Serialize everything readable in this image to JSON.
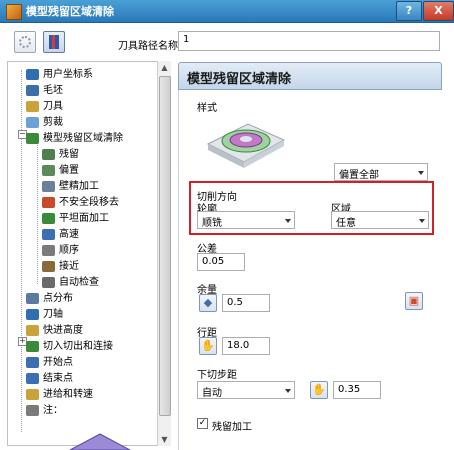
{
  "window": {
    "title": "模型残留区域清除",
    "help_label": "?",
    "close_label": "X"
  },
  "toolpath_name": {
    "label": "刀具路径名称",
    "value": "1"
  },
  "tree": {
    "items": [
      {
        "label": "用户坐标系",
        "icon": "ucs-icon",
        "color": "#2f6fb0"
      },
      {
        "label": "毛坯",
        "icon": "block-icon",
        "color": "#3c6ea8"
      },
      {
        "label": "刀具",
        "icon": "tool-icon",
        "color": "#c9a23a"
      },
      {
        "label": "剪裁",
        "icon": "trim-icon",
        "color": "#6aa2d8"
      },
      {
        "label": "模型残留区域清除",
        "icon": "strategy-icon",
        "color": "#3a8a3a"
      },
      {
        "label": "残留",
        "icon": "rest-icon",
        "color": "#4f7f4f"
      },
      {
        "label": "偏置",
        "icon": "offset-icon",
        "color": "#5a8a5a"
      },
      {
        "label": "壁精加工",
        "icon": "wall-finish-icon",
        "color": "#6a7f9a"
      },
      {
        "label": "不安全段移去",
        "icon": "unsafe-segment-icon",
        "color": "#c94a2a"
      },
      {
        "label": "平坦面加工",
        "icon": "flat-face-icon",
        "color": "#3a8a3a"
      },
      {
        "label": "高速",
        "icon": "high-speed-icon",
        "color": "#3a6fb0"
      },
      {
        "label": "顺序",
        "icon": "order-icon",
        "color": "#7a7a7a"
      },
      {
        "label": "接近",
        "icon": "approach-icon",
        "color": "#8a6a3a"
      },
      {
        "label": "自动检查",
        "icon": "auto-check-icon",
        "color": "#6a6a6a"
      },
      {
        "label": "点分布",
        "icon": "point-distribution-icon",
        "color": "#5a7aa0"
      },
      {
        "label": "刀轴",
        "icon": "tool-axis-icon",
        "color": "#2f6fb0"
      },
      {
        "label": "快进高度",
        "icon": "rapid-height-icon",
        "color": "#c9a23a"
      },
      {
        "label": "切入切出和连接",
        "icon": "leads-links-icon",
        "color": "#3a8a3a"
      },
      {
        "label": "开始点",
        "icon": "start-point-icon",
        "color": "#3a6fb0"
      },
      {
        "label": "结束点",
        "icon": "end-point-icon",
        "color": "#3a6fb0"
      },
      {
        "label": "进给和转速",
        "icon": "feeds-speeds-icon",
        "color": "#c9a23a"
      },
      {
        "label": "注：",
        "icon": "notes-icon",
        "color": "#7a7a7a"
      }
    ]
  },
  "panel": {
    "title": "模型残留区域清除",
    "style": {
      "label": "样式",
      "value": "偏置全部"
    },
    "cut_direction": {
      "label": "切削方向",
      "profile_label": "轮廓",
      "profile_value": "顺铣",
      "area_label": "区域",
      "area_value": "任意"
    },
    "tolerance": {
      "label": "公差",
      "value": "0.05"
    },
    "allowance": {
      "label": "余量",
      "value": "0.5"
    },
    "stepover": {
      "label": "行距",
      "value": "18.0"
    },
    "stepdown": {
      "label": "下切步距",
      "mode": "自动",
      "value": "0.35"
    },
    "rest_machining": {
      "label": "残留加工",
      "checked": true
    }
  }
}
